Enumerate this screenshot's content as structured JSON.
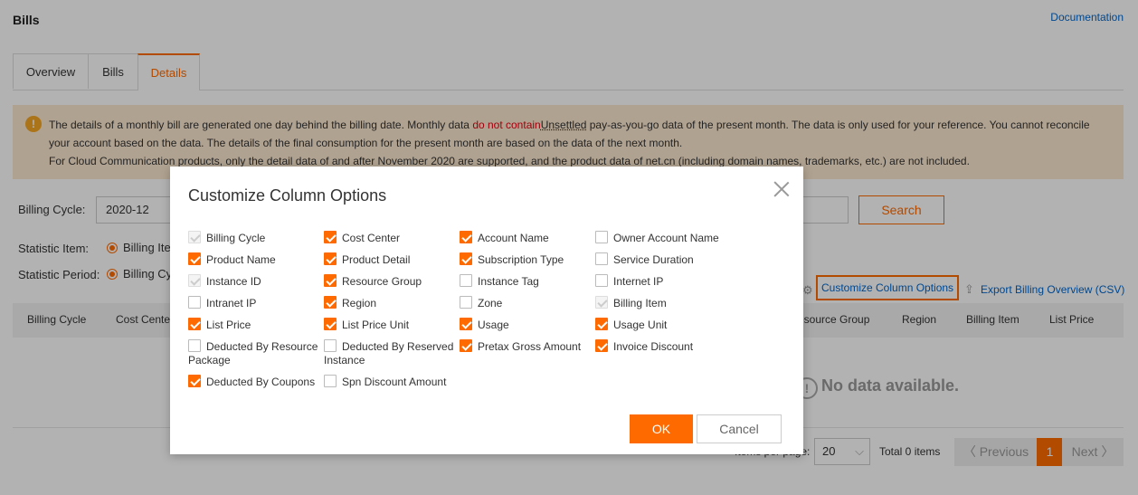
{
  "header": {
    "title": "Bills",
    "doc_link": "Documentation"
  },
  "tabs": [
    {
      "label": "Overview"
    },
    {
      "label": "Bills"
    },
    {
      "label": "Details"
    }
  ],
  "notice": {
    "line1_a": "The details of a monthly bill are generated one day behind the billing date. Monthly data ",
    "line1_hl": "do not contain",
    "line1_ul": "Unsettled",
    "line1_b": " pay-as-you-go data of the present month. The data is only used for your reference. You cannot reconcile",
    "line2": "your account based on the data. The details of the final consumption for the present month are based on the data of the next month.",
    "line3": "For Cloud Communication products, only the detail data of and after November 2020 are supported, and the product data of net.cn (including domain names, trademarks, etc.) are not included."
  },
  "filters": {
    "billing_cycle_label": "Billing Cycle:",
    "billing_cycle_value": "2020-12",
    "statistic_item_label": "Statistic Item:",
    "statistic_item_value": "Billing Ite",
    "statistic_period_label": "Statistic Period:",
    "statistic_period_value": "Billing Cy",
    "search_label": "Search"
  },
  "actions": {
    "customize_label": "Customize Column Options",
    "export_label": "Export Billing Overview (CSV)"
  },
  "table": {
    "columns_left": [
      "Billing Cycle",
      "Cost Cente"
    ],
    "columns_right": [
      "esource Group",
      "Region",
      "Billing Item",
      "List Price"
    ],
    "empty": "No data available."
  },
  "pagination": {
    "items_per_page_label": "Items per page:",
    "page_size": "20",
    "total": "Total 0 items",
    "previous": "Previous",
    "current": "1",
    "next": "Next"
  },
  "modal": {
    "title": "Customize Column Options",
    "ok": "OK",
    "cancel": "Cancel",
    "options": [
      {
        "label": "Billing Cycle",
        "state": "disabled"
      },
      {
        "label": "Cost Center",
        "state": "checked"
      },
      {
        "label": "Account Name",
        "state": "checked"
      },
      {
        "label": "Owner Account Name",
        "state": "unchecked"
      },
      {
        "label": "Product Name",
        "state": "checked"
      },
      {
        "label": "Product Detail",
        "state": "checked"
      },
      {
        "label": "Subscription Type",
        "state": "checked"
      },
      {
        "label": "Service Duration",
        "state": "unchecked"
      },
      {
        "label": "Instance ID",
        "state": "disabled"
      },
      {
        "label": "Resource Group",
        "state": "checked"
      },
      {
        "label": "Instance Tag",
        "state": "unchecked"
      },
      {
        "label": "Internet IP",
        "state": "unchecked"
      },
      {
        "label": "Intranet IP",
        "state": "unchecked"
      },
      {
        "label": "Region",
        "state": "checked"
      },
      {
        "label": "Zone",
        "state": "unchecked"
      },
      {
        "label": "Billing Item",
        "state": "disabled"
      },
      {
        "label": "List Price",
        "state": "checked"
      },
      {
        "label": "List Price Unit",
        "state": "checked"
      },
      {
        "label": "Usage",
        "state": "checked"
      },
      {
        "label": "Usage Unit",
        "state": "checked"
      },
      {
        "label": "Deducted By Resource Package",
        "state": "unchecked"
      },
      {
        "label": "Deducted By Reserved Instance",
        "state": "unchecked"
      },
      {
        "label": "Pretax Gross Amount",
        "state": "checked"
      },
      {
        "label": "Invoice Discount",
        "state": "checked"
      },
      {
        "label": "Deducted By Coupons",
        "state": "checked"
      },
      {
        "label": "Spn Discount Amount",
        "state": "unchecked"
      }
    ]
  },
  "colors": {
    "accent": "#ff6a00",
    "link": "#0066cc",
    "notice_bg": "#fde8cf"
  }
}
